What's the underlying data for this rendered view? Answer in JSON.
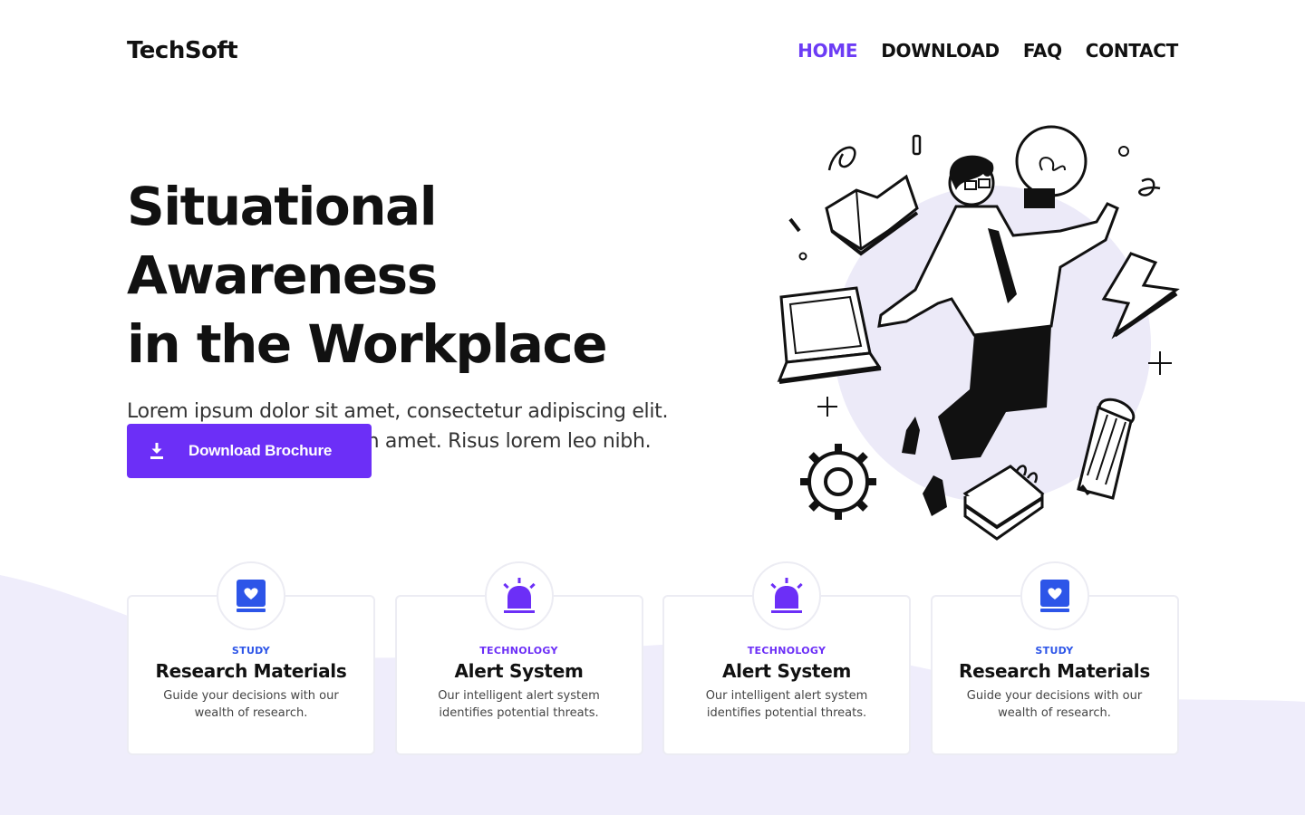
{
  "brand": {
    "name": "TechSoft",
    "accent": "#6c2ff7",
    "nav_active_color": "#6c3cf5"
  },
  "nav": {
    "items": [
      {
        "label": "HOME",
        "active": true
      },
      {
        "label": "DOWNLOAD",
        "active": false
      },
      {
        "label": "FAQ",
        "active": false
      },
      {
        "label": "CONTACT",
        "active": false
      }
    ]
  },
  "hero": {
    "title_line1": "Situational Awareness",
    "title_line2": "in the Workplace",
    "subtitle_line1": "Lorem ipsum dolor sit amet, consectetur adipiscing elit.",
    "subtitle_line2": "Amet sed urna, gravida in amet. Risus lorem leo nibh.",
    "cta_label": "Download Brochure",
    "cta_icon": "download-icon"
  },
  "cards": [
    {
      "category": "STUDY",
      "category_color": "#2d55e8",
      "title": "Research Materials",
      "desc": "Guide your decisions with our wealth of research.",
      "icon": "book-heart-icon"
    },
    {
      "category": "TECHNOLOGY",
      "category_color": "#6c2ff7",
      "title": "Alert System",
      "desc": "Our intelligent alert system identifies potential threats.",
      "icon": "siren-icon"
    },
    {
      "category": "TECHNOLOGY",
      "category_color": "#6c2ff7",
      "title": "Alert System",
      "desc": "Our intelligent alert system identifies potential threats.",
      "icon": "siren-icon"
    },
    {
      "category": "STUDY",
      "category_color": "#2d55e8",
      "title": "Research Materials",
      "desc": "Guide your decisions with our wealth of research.",
      "icon": "book-heart-icon"
    }
  ]
}
